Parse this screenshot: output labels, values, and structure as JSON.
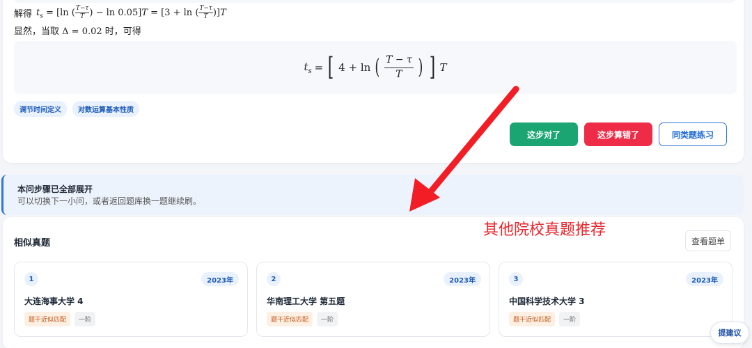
{
  "solution": {
    "line1_prefix": "解得",
    "line2_prefix": "显然，当取",
    "line2_delta": "Δ = 0.02",
    "line2_suffix": "时，可得"
  },
  "tags": [
    "调节时间定义",
    "对数运算基本性质"
  ],
  "actions": {
    "correct": "这步对了",
    "wrong": "这步算错了",
    "practice": "同类题练习"
  },
  "banner": {
    "title": "本问步骤已全部展开",
    "subtitle": "可以切换下一小问，或者返回题库换一题继续刷。"
  },
  "similar": {
    "title": "相似真题",
    "view_list": "查看题单",
    "items": [
      {
        "num": "1",
        "year": "2023年",
        "name": "大连海事大学 4",
        "tag1": "题干近似匹配",
        "tag2": "一阶"
      },
      {
        "num": "2",
        "year": "2023年",
        "name": "华南理工大学 第五题",
        "tag1": "题干近似匹配",
        "tag2": "一阶"
      },
      {
        "num": "3",
        "year": "2023年",
        "name": "中国科学技术大学 3",
        "tag1": "题干近似匹配",
        "tag2": "一阶"
      }
    ]
  },
  "suggest": "提建议",
  "annotation": {
    "text": "其他院校真题推荐",
    "color": "#e8262d"
  },
  "colors": {
    "green": "#1aa573",
    "red": "#ef2c48",
    "blue": "#2f74d8"
  }
}
